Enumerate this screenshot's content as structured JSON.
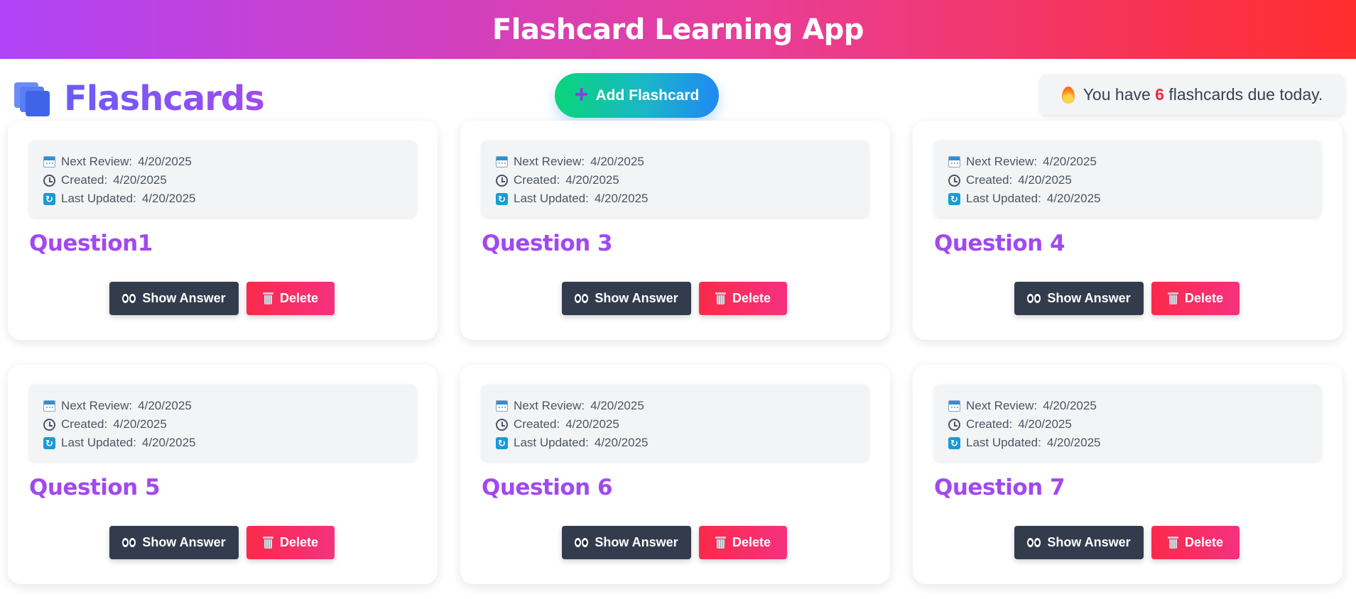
{
  "header": {
    "title": "Flashcard Learning App"
  },
  "page": {
    "title": "Flashcards",
    "add_button_label": "Add Flashcard",
    "due_prefix": "You have",
    "due_count": "6",
    "due_suffix": "flashcards due today."
  },
  "labels": {
    "next_review": "Next Review:",
    "created": "Created:",
    "last_updated": "Last Updated:",
    "show_answer": "Show Answer",
    "delete": "Delete"
  },
  "cards": [
    {
      "question": "Question1",
      "next_review": "4/20/2025",
      "created": "4/20/2025",
      "last_updated": "4/20/2025"
    },
    {
      "question": "Question 3",
      "next_review": "4/20/2025",
      "created": "4/20/2025",
      "last_updated": "4/20/2025"
    },
    {
      "question": "Question 4",
      "next_review": "4/20/2025",
      "created": "4/20/2025",
      "last_updated": "4/20/2025"
    },
    {
      "question": "Question 5",
      "next_review": "4/20/2025",
      "created": "4/20/2025",
      "last_updated": "4/20/2025"
    },
    {
      "question": "Question 6",
      "next_review": "4/20/2025",
      "created": "4/20/2025",
      "last_updated": "4/20/2025"
    },
    {
      "question": "Question 7",
      "next_review": "4/20/2025",
      "created": "4/20/2025",
      "last_updated": "4/20/2025"
    }
  ],
  "icons": {
    "title": "cards-stack-icon",
    "add": "plus-icon",
    "due": "fire-icon",
    "next_review": "calendar-icon",
    "created": "clock-icon",
    "last_updated": "refresh-icon",
    "show_answer": "eyes-icon",
    "delete": "trash-icon"
  },
  "colors": {
    "header_gradient": [
      "#b044f7",
      "#e83e9a",
      "#ff2d2d"
    ],
    "question": "#a149f0",
    "show_answer_bg": "#323c4d",
    "delete_gradient": [
      "#fb2a4a",
      "#f5317f"
    ],
    "due_count": "#ef2b3d"
  }
}
